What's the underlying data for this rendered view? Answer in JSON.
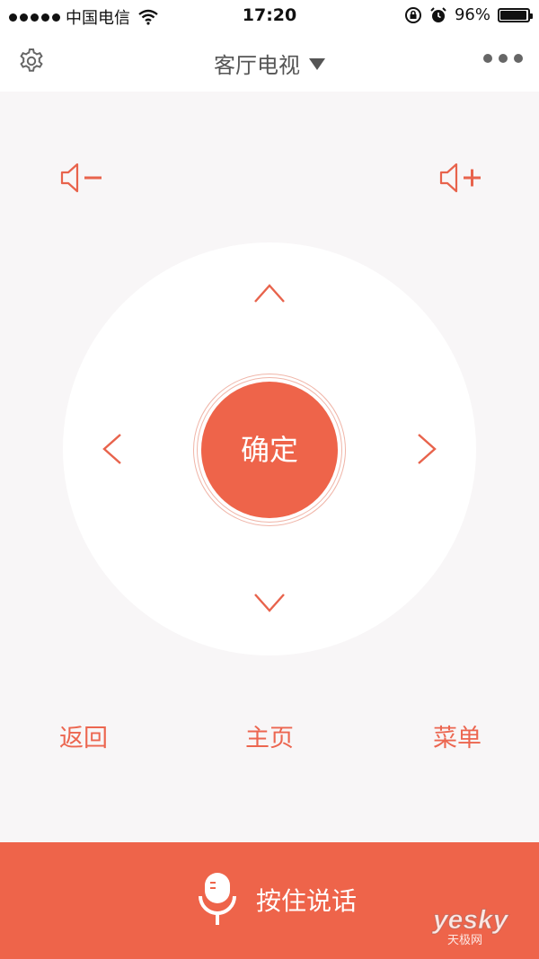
{
  "status_bar": {
    "carrier": "中国电信",
    "time": "17:20",
    "battery": "96%",
    "battery_level": 0.96
  },
  "nav": {
    "title": "客厅电视"
  },
  "remote": {
    "ok_label": "确定"
  },
  "functions": {
    "back_label": "返回",
    "home_label": "主页",
    "menu_label": "菜单"
  },
  "voice": {
    "label": "按住说话"
  },
  "watermark": {
    "brand": "yesky",
    "sub": "天极网"
  },
  "colors": {
    "accent": "#ee644a",
    "background": "#f8f6f7"
  },
  "icons": {
    "settings": "gear-icon",
    "more": "more-icon",
    "volume_down": "volume-down-icon",
    "volume_up": "volume-up-icon",
    "up": "chevron-up-icon",
    "down": "chevron-down-icon",
    "left": "chevron-left-icon",
    "right": "chevron-right-icon",
    "mic": "microphone-icon"
  }
}
